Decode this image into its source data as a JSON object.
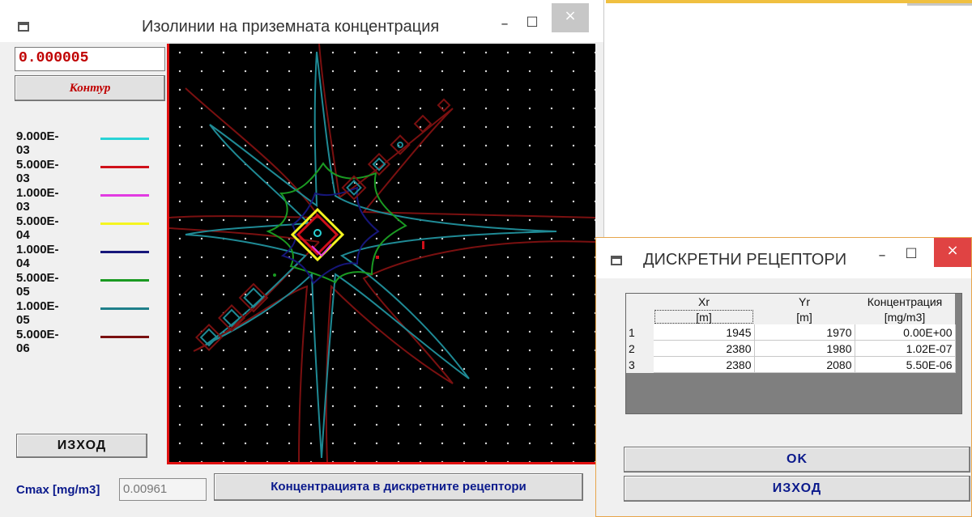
{
  "main_window": {
    "title": "Изолинии на приземната концентрация",
    "minimize_label": "–",
    "maximize_label": "□",
    "close_label": "×",
    "value_input": "0.000005",
    "kontur_button": "Контур",
    "legend": [
      {
        "label": "9.000E-03",
        "color": "#29d3d6"
      },
      {
        "label": "5.000E-03",
        "color": "#d0101a"
      },
      {
        "label": "1.000E-03",
        "color": "#e23be2"
      },
      {
        "label": "5.000E-04",
        "color": "#f5f520"
      },
      {
        "label": "1.000E-04",
        "color": "#16167a"
      },
      {
        "label": "5.000E-05",
        "color": "#1a9a22"
      },
      {
        "label": "1.000E-05",
        "color": "#1f7f8a"
      },
      {
        "label": "5.000E-06",
        "color": "#7a1010"
      }
    ],
    "exit_button": "ИЗХОД",
    "cmax_label": "Cmax [mg/m3]",
    "cmax_value": "0.00961",
    "discrete_button": "Концентрацията в дискретните рецептори"
  },
  "receptors_window": {
    "title": "ДИСКРЕТНИ РЕЦЕПТОРИ",
    "minimize_label": "–",
    "maximize_label": "□",
    "close_label": "×",
    "columns": [
      "Xr",
      "Yr",
      "Концентрация"
    ],
    "units": [
      "[m]",
      "[m]",
      "[mg/m3]"
    ],
    "rows": [
      {
        "n": "1",
        "x": "1945",
        "y": "1970",
        "c": "0.00E+00"
      },
      {
        "n": "2",
        "x": "2380",
        "y": "1980",
        "c": "1.02E-07"
      },
      {
        "n": "3",
        "x": "2380",
        "y": "2080",
        "c": "5.50E-06"
      }
    ],
    "ok_button": "OK",
    "exit_button": "ИЗХОД"
  }
}
